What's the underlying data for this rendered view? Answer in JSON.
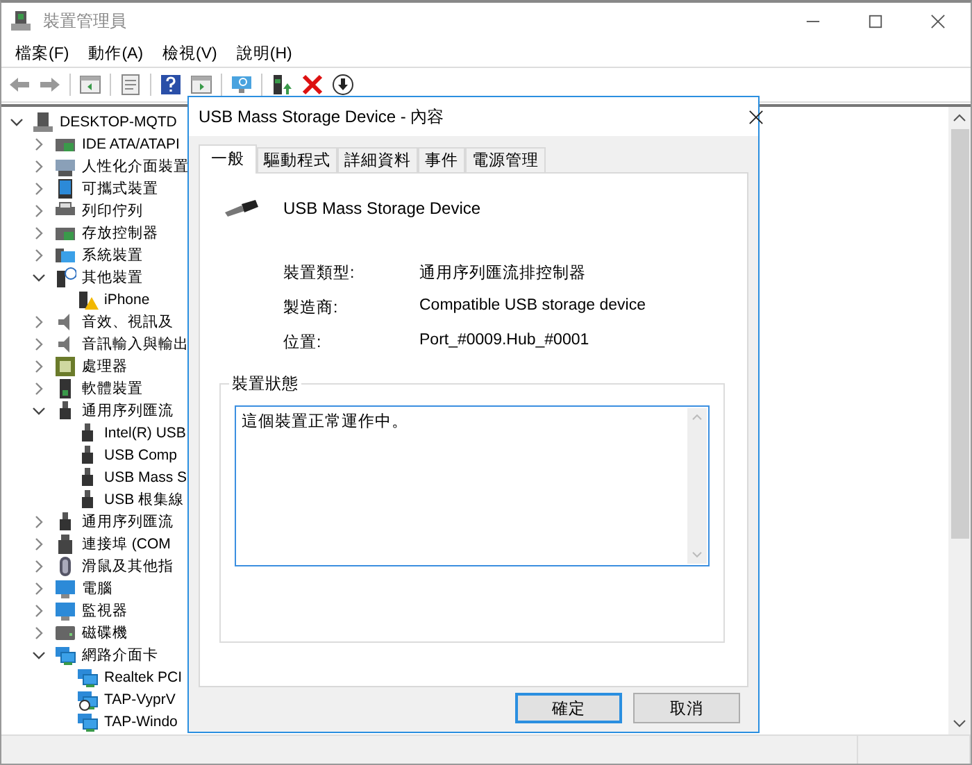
{
  "window": {
    "title": "裝置管理員"
  },
  "menu": [
    "檔案(F)",
    "動作(A)",
    "檢視(V)",
    "說明(H)"
  ],
  "tree": {
    "label": "DESKTOP-MQTD",
    "kind": "computer",
    "expanded": true,
    "children": [
      {
        "label": "IDE ATA/ATAPI",
        "kind": "storage",
        "expanded": false
      },
      {
        "label": "人性化介面裝置",
        "kind": "hid",
        "expanded": false
      },
      {
        "label": "可攜式裝置",
        "kind": "portable",
        "expanded": false
      },
      {
        "label": "列印佇列",
        "kind": "printer",
        "expanded": false
      },
      {
        "label": "存放控制器",
        "kind": "storage",
        "expanded": false
      },
      {
        "label": "系統裝置",
        "kind": "system",
        "expanded": false
      },
      {
        "label": "其他裝置",
        "kind": "other",
        "expanded": true,
        "children": [
          {
            "label": "iPhone",
            "kind": "warning"
          }
        ]
      },
      {
        "label": "音效、視訊及",
        "kind": "audio",
        "expanded": false
      },
      {
        "label": "音訊輸入與輸出",
        "kind": "audio",
        "expanded": false
      },
      {
        "label": "處理器",
        "kind": "processor",
        "expanded": false
      },
      {
        "label": "軟體裝置",
        "kind": "software",
        "expanded": false
      },
      {
        "label": "通用序列匯流",
        "kind": "usb",
        "expanded": true,
        "children": [
          {
            "label": "Intel(R) USB",
            "kind": "usb"
          },
          {
            "label": "USB Comp",
            "kind": "usb"
          },
          {
            "label": "USB Mass S",
            "kind": "usb"
          },
          {
            "label": "USB 根集線",
            "kind": "usb"
          }
        ]
      },
      {
        "label": "通用序列匯流",
        "kind": "usb",
        "expanded": false
      },
      {
        "label": "連接埠 (COM",
        "kind": "port",
        "expanded": false
      },
      {
        "label": "滑鼠及其他指",
        "kind": "mouse",
        "expanded": false
      },
      {
        "label": "電腦",
        "kind": "monitor",
        "expanded": false
      },
      {
        "label": "監視器",
        "kind": "monitor",
        "expanded": false
      },
      {
        "label": "磁碟機",
        "kind": "drive",
        "expanded": false
      },
      {
        "label": "網路介面卡",
        "kind": "network",
        "expanded": true,
        "children": [
          {
            "label": "Realtek PCI",
            "kind": "network"
          },
          {
            "label": "TAP-VyprV",
            "kind": "network-vpn"
          },
          {
            "label": "TAP-Windo",
            "kind": "network"
          }
        ]
      }
    ]
  },
  "dialog": {
    "title": "USB Mass Storage Device - 內容",
    "tabs": [
      {
        "label": "一般",
        "selected": true
      },
      {
        "label": "驅動程式",
        "selected": false
      },
      {
        "label": "詳細資料",
        "selected": false
      },
      {
        "label": "事件",
        "selected": false
      },
      {
        "label": "電源管理",
        "selected": false
      }
    ],
    "device_name": "USB Mass Storage Device",
    "properties": [
      {
        "label": "裝置類型:",
        "value": "通用序列匯流排控制器"
      },
      {
        "label": "製造商:",
        "value": "Compatible USB storage device"
      },
      {
        "label": "位置:",
        "value": "Port_#0009.Hub_#0001"
      }
    ],
    "status": {
      "title": "裝置狀態",
      "text": "這個裝置正常運作中。"
    },
    "buttons": [
      {
        "label": "確定",
        "default": true
      },
      {
        "label": "取消",
        "default": false
      }
    ]
  }
}
